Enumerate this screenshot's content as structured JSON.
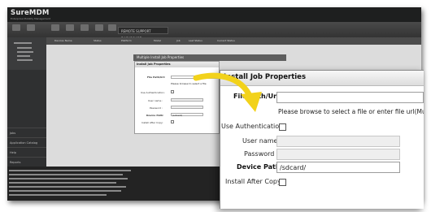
{
  "app": {
    "logo": "SureMDM",
    "logo_sub": "Enterprise Mobility Management"
  },
  "toolbar": {
    "tab_label": "REMOTE SUPPORT DASHBOARD"
  },
  "sidebar": {
    "items": [
      "Jobs",
      "Application Catalog",
      "Help",
      "Reports"
    ]
  },
  "grid": {
    "columns": [
      "Devices Name",
      "Status",
      "Platform",
      "Model",
      "Job",
      "Last Status",
      "Current Status"
    ]
  },
  "small_dialog": {
    "window_title": "Multiple Install Job Properties",
    "header": "Install Job Properties",
    "file_path_label": "File Path/Url:",
    "hint": "Please browse to select a file",
    "use_auth_label": "Use Authentication:",
    "username_label": "User name :",
    "password_label": "Password :",
    "device_path_label": "Device Path:",
    "device_path_value": "/sdcard/",
    "install_after_copy_label": "Install After Copy:"
  },
  "dialog": {
    "title": "Install Job Properties",
    "file_path_label": "File Path/Url:",
    "file_path_value": "",
    "hint": "Please browse to select a file or enter file url(Must",
    "use_auth_label": "Use Authentication:",
    "use_auth_checked": false,
    "username_label": "User name :",
    "username_value": "",
    "password_label": "Password :",
    "password_value": "",
    "device_path_label": "Device Path:",
    "device_path_value": "/sdcard/",
    "install_after_copy_label": "Install After Copy:",
    "install_after_copy_checked": false
  },
  "colors": {
    "arrow": "#f2d21b",
    "topbar": "#1e1f1f",
    "toolbar": "#3d3d3d",
    "sidebar": "#2f3031",
    "log_panel": "#232323"
  }
}
